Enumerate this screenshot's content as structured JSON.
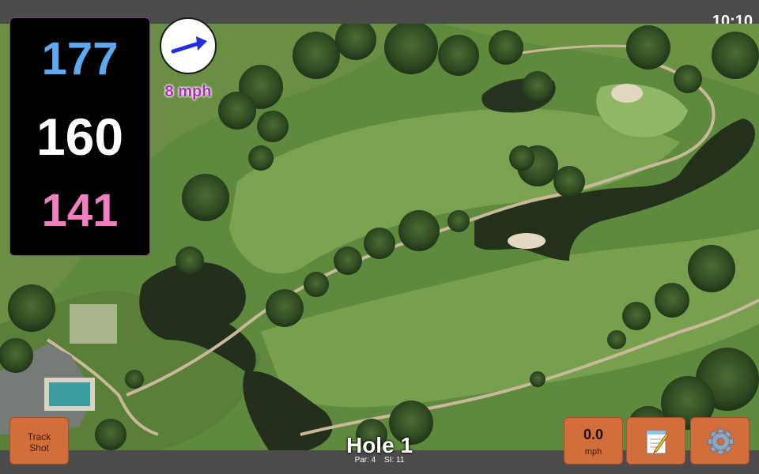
{
  "status_bar": {
    "time": "10:10"
  },
  "distances": {
    "back": "177",
    "middle": "160",
    "front": "141",
    "colors": {
      "back": "#5ea8f0",
      "middle": "#ffffff",
      "front": "#ef7fbf"
    }
  },
  "wind": {
    "speed_label": "8 mph",
    "arrow_icon": "wind-direction-arrow",
    "arrow_color": "#1f2fe0",
    "label_color": "#b02fb8"
  },
  "buttons": {
    "track_shot": {
      "line1": "Track",
      "line2": "Shot"
    },
    "speed": {
      "value": "0.0",
      "unit": "mph"
    },
    "notes": {
      "icon": "notepad-icon"
    },
    "settings": {
      "icon": "gear-icon"
    },
    "button_color": "#d36d3c"
  },
  "hole": {
    "title": "Hole 1",
    "par": "Par: 4",
    "stroke_index": "SI: 11"
  }
}
